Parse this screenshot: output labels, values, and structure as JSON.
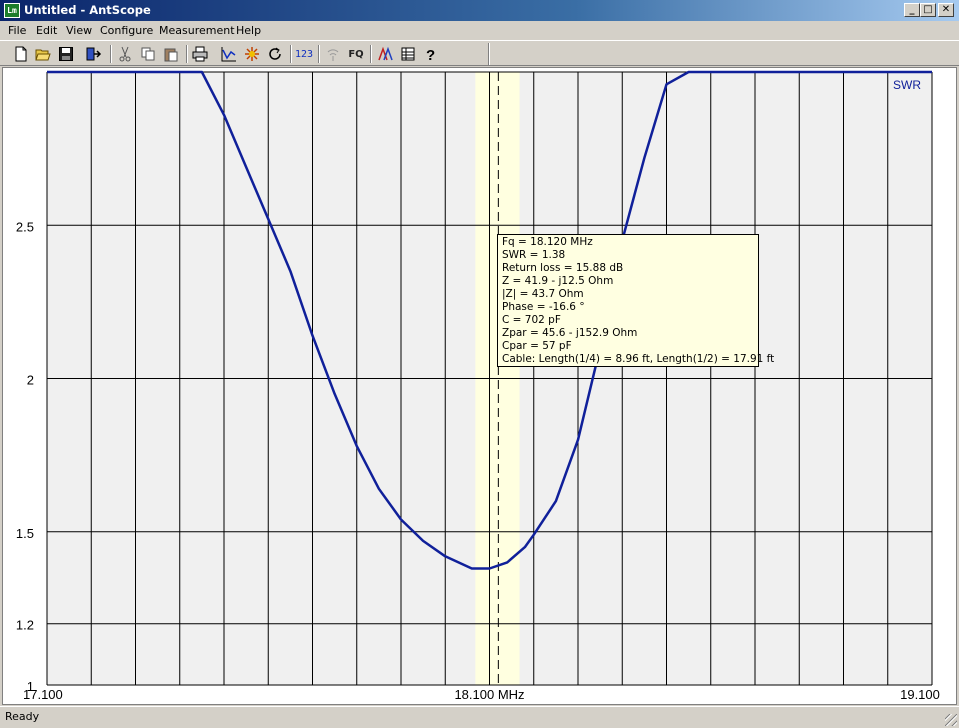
{
  "window": {
    "title": "Untitled - AntScope",
    "icon_label": "Lm",
    "min_label": "_",
    "max_label": "□",
    "close_label": "✕"
  },
  "menu": [
    "File",
    "Edit",
    "View",
    "Configure",
    "Measurement",
    "Help"
  ],
  "toolbar": {
    "icons": [
      "new-file-icon",
      "open-folder-icon",
      "save-disk-icon",
      "export-icon",
      "cut-icon",
      "copy-icon",
      "paste-icon",
      "print-icon",
      "graph-icon",
      "settings-spark-icon",
      "refresh-icon",
      "numeric-123-icon",
      "antenna-icon",
      "fq-icon",
      "multi-curve-icon",
      "table-icon",
      "help-icon"
    ],
    "label_123": "123",
    "label_fq": "FQ"
  },
  "chart_data": {
    "type": "line",
    "series": [
      {
        "name": "SWR",
        "color": "#10209a",
        "x": [
          17.45,
          17.5,
          17.55,
          17.6,
          17.65,
          17.7,
          17.75,
          17.8,
          17.85,
          17.9,
          17.95,
          18.0,
          18.03,
          18.06,
          18.1,
          18.14,
          18.18,
          18.2,
          18.25,
          18.3,
          18.35,
          18.4,
          18.45,
          18.5,
          18.55,
          18.6,
          18.63
        ],
        "y": [
          3.0,
          2.86,
          2.69,
          2.52,
          2.35,
          2.14,
          1.95,
          1.78,
          1.64,
          1.54,
          1.47,
          1.42,
          1.4,
          1.38,
          1.38,
          1.4,
          1.45,
          1.49,
          1.6,
          1.8,
          2.1,
          2.45,
          2.72,
          2.96,
          3.0,
          3.0,
          3.0
        ]
      }
    ],
    "series_label": "SWR",
    "xlim": [
      17.1,
      19.1
    ],
    "ylim": [
      1.0,
      3.0
    ],
    "y_ticks": [
      {
        "value": 2.5,
        "label": "2.5"
      },
      {
        "value": 2.0,
        "label": "2"
      },
      {
        "value": 1.5,
        "label": "1.5"
      },
      {
        "value": 1.2,
        "label": "1.2"
      },
      {
        "value": 1.0,
        "label": "1"
      }
    ],
    "x_ticks": [
      {
        "value": 17.1,
        "label": "17.100"
      },
      {
        "value": 18.1,
        "label": "18.100 MHz"
      },
      {
        "value": 19.1,
        "label": "19.100"
      }
    ],
    "x_gridlines": 20,
    "cursor_fq": 18.12,
    "band": [
      18.068,
      18.168
    ],
    "band_color": "#ffffe0",
    "grid": true
  },
  "tooltip": {
    "lines": [
      "Fq = 18.120 MHz",
      "SWR = 1.38",
      "Return loss = 15.88 dB",
      "Z = 41.9 - j12.5 Ohm",
      "|Z| = 43.7 Ohm",
      "Phase = -16.6 °",
      "C = 702 pF",
      "Zpar = 45.6 - j152.9 Ohm",
      "Cpar = 57 pF",
      "Cable: Length(1/4) = 8.96 ft, Length(1/2) = 17.91 ft"
    ]
  },
  "status": {
    "text": "Ready"
  }
}
